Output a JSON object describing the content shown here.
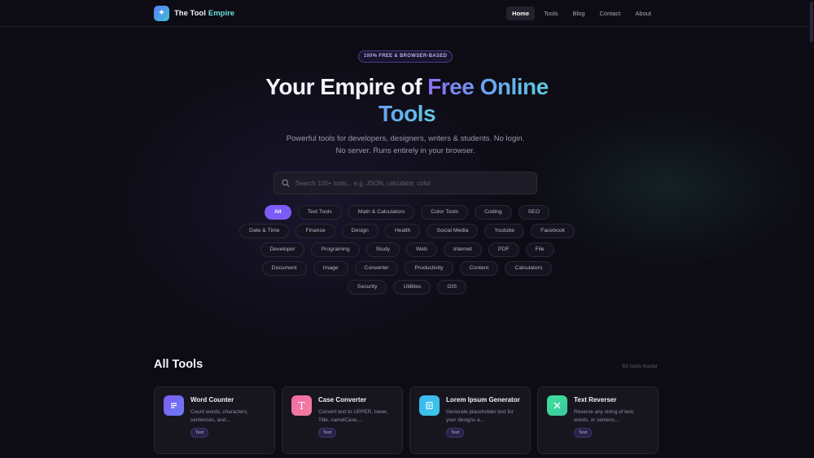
{
  "nav": {
    "brand_main": "The Tool",
    "brand_accent": "Empire",
    "links": [
      "Home",
      "Tools",
      "Blog",
      "Contact",
      "About"
    ],
    "active": "Home"
  },
  "hero": {
    "badge": "100% FREE & BROWSER-BASED",
    "title_plain": "Your Empire of ",
    "title_gradient": "Free Online",
    "title_line2": "Tools",
    "subtitle": "Powerful tools for developers, designers, writers & students. No login. No server. Runs entirely in your browser."
  },
  "search": {
    "placeholder": "Search 100+ tools... e.g. JSON, calculator, color",
    "value": ""
  },
  "categories": {
    "rows": [
      [
        "All",
        "Text Tools",
        "Math & Calculators",
        "Color Tools",
        "Coding",
        "SEO"
      ],
      [
        "Date & Time",
        "Finance",
        "Design",
        "Health",
        "Social Media",
        "Youtube",
        "Facebook"
      ],
      [
        "Developer",
        "Programing",
        "Study",
        "Web",
        "Internet",
        "PDF",
        "File"
      ],
      [
        "Document",
        "Image",
        "Converter",
        "Productivity",
        "Content",
        "Calculators"
      ],
      [
        "Security",
        "Utilities",
        "GIS"
      ]
    ],
    "active": "All"
  },
  "tools_section": {
    "title": "All Tools",
    "count": "55 tools found",
    "cards": [
      {
        "title": "Word Counter",
        "desc": "Count words, characters, sentences, and...",
        "tag": "Text",
        "icon": "lines-icon",
        "color_from": "#7c5cf0",
        "color_to": "#6a7cf5"
      },
      {
        "title": "Case Converter",
        "desc": "Convert text to UPPER, lower, Title, camelCase,...",
        "tag": "Text",
        "icon": "t-letter-icon",
        "color_from": "#f06aa8",
        "color_to": "#f37fa0"
      },
      {
        "title": "Lorem Ipsum Generator",
        "desc": "Generate placeholder text for your designs a...",
        "tag": "Text",
        "icon": "document-icon",
        "color_from": "#3fb6f0",
        "color_to": "#38c8e6"
      },
      {
        "title": "Text Reverser",
        "desc": "Reverse any string of text, words, or sentenc...",
        "tag": "Text",
        "icon": "cross-icon",
        "color_from": "#3fe09a",
        "color_to": "#38c8a0"
      }
    ]
  }
}
